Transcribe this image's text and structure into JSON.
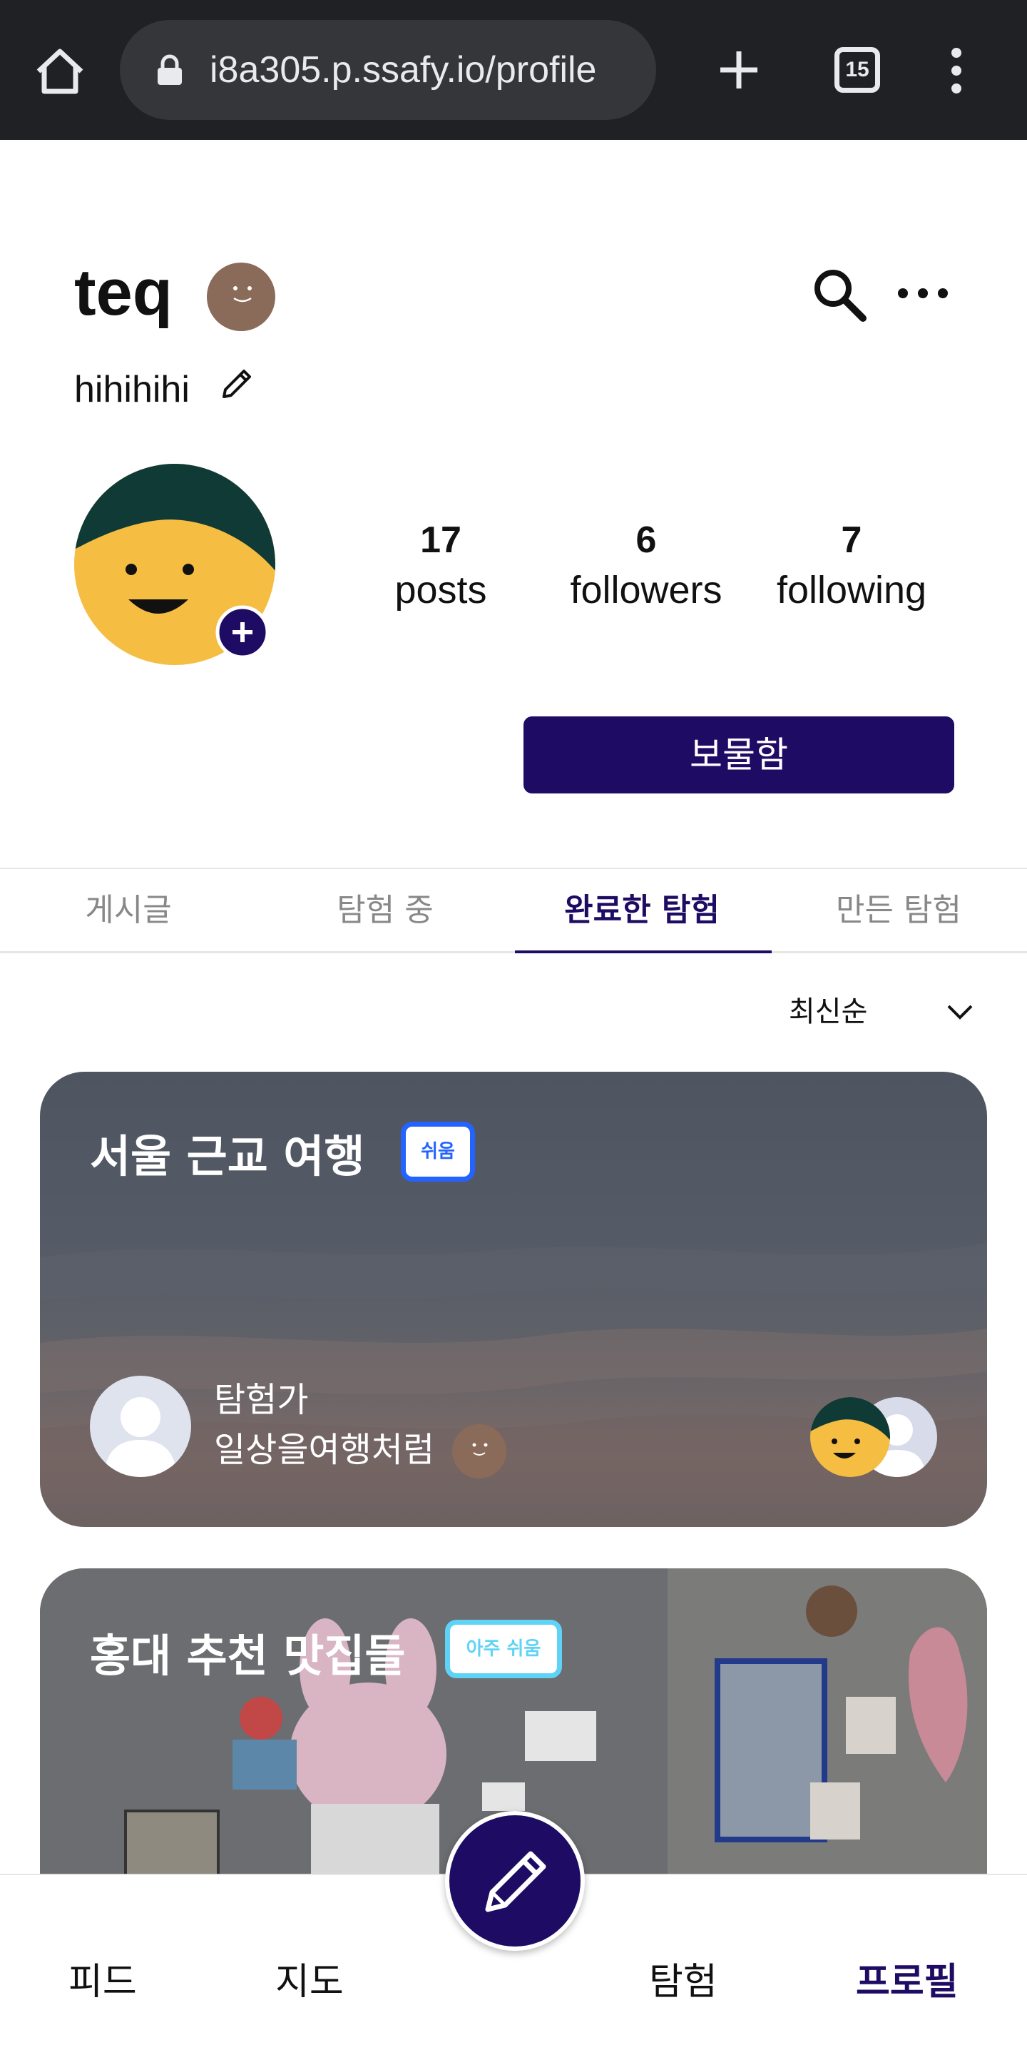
{
  "browser": {
    "url": "i8a305.p.ssafy.io/profile",
    "tab_count": "15"
  },
  "profile": {
    "username": "teq",
    "bio": "hihihihi",
    "stats": [
      {
        "value": "17",
        "label": "posts"
      },
      {
        "value": "6",
        "label": "followers"
      },
      {
        "value": "7",
        "label": "following"
      }
    ],
    "treasure_button": "보물함"
  },
  "tabs": [
    {
      "label": "게시글",
      "active": false
    },
    {
      "label": "탐험 중",
      "active": false
    },
    {
      "label": "완료한 탐험",
      "active": true
    },
    {
      "label": "만든 탐험",
      "active": false
    }
  ],
  "sort": {
    "selected": "최신순"
  },
  "cards": [
    {
      "title": "서울 근교 여행",
      "badge": "쉬움",
      "badge_color": "#2463ff",
      "author_role": "탐험가",
      "author_name": "일상을여행처럼"
    },
    {
      "title": "홍대 추천 맛집들",
      "badge": "아주 쉬움",
      "badge_color": "#5fd3f5"
    }
  ],
  "nav": {
    "feed": "피드",
    "map": "지도",
    "explore": "탐험",
    "profile": "프로필"
  },
  "colors": {
    "brand": "#1e0b64",
    "avatar_yellow": "#f5bd42",
    "avatar_hat": "#0f3a36",
    "smiley_brown": "#8a6a58"
  }
}
